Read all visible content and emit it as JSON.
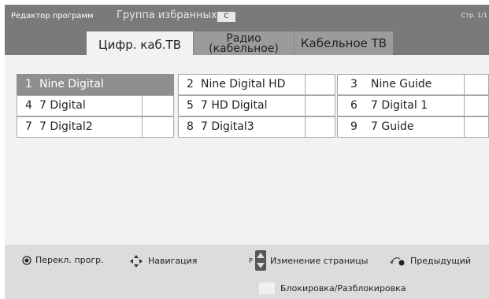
{
  "header": {
    "editor_title": "Редактор программ",
    "favorites_label": "Группа избранных:",
    "favorites_value": "C",
    "page_indicator": "Стр. 1/1"
  },
  "tabs": [
    {
      "label": "Цифр. каб.ТВ",
      "active": true
    },
    {
      "label": "Радио\n(кабельное)",
      "active": false
    },
    {
      "label": "Кабельное ТВ",
      "active": false
    }
  ],
  "channels": [
    {
      "num": "1",
      "name": "Nine Digital",
      "selected": true
    },
    {
      "num": "2",
      "name": "Nine Digital HD",
      "selected": false
    },
    {
      "num": "3",
      "name": "Nine Guide",
      "selected": false
    },
    {
      "num": "4",
      "name": "7 Digital",
      "selected": false
    },
    {
      "num": "5",
      "name": "7 HD Digital",
      "selected": false
    },
    {
      "num": "6",
      "name": "7 Digital 1",
      "selected": false
    },
    {
      "num": "7",
      "name": "7 Digital2",
      "selected": false
    },
    {
      "num": "8",
      "name": "7 Digital3",
      "selected": false
    },
    {
      "num": "9",
      "name": "7 Guide",
      "selected": false
    }
  ],
  "legend": {
    "toggle": "Перекл. прогр.",
    "navigation": "Навигация",
    "page_change_key": "P",
    "page_change": "Изменение страницы",
    "previous": "Предыдущий",
    "lock": "Блокировка/Разблокировка"
  },
  "icons": {
    "toggle": "ok-button-icon",
    "navigation": "four-way-arrows-icon",
    "page_change": "page-up-down-icon",
    "previous": "back-arrow-icon"
  },
  "colors": {
    "header_bg": "#7a7a7a",
    "body_bg": "#f2f2f2",
    "selected_bg": "#8f8f8f",
    "footer_bg": "#dcdcdc"
  }
}
